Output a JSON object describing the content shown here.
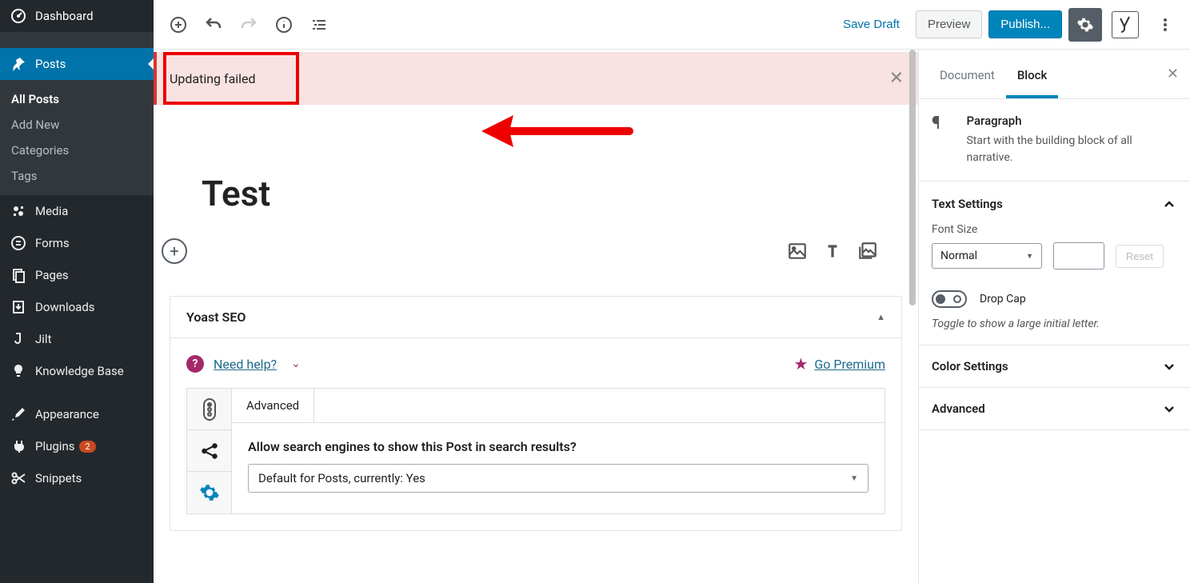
{
  "sidebar": {
    "dashboard": "Dashboard",
    "posts": "Posts",
    "sub": {
      "all": "All Posts",
      "add": "Add New",
      "categories": "Categories",
      "tags": "Tags"
    },
    "media": "Media",
    "forms": "Forms",
    "pages": "Pages",
    "downloads": "Downloads",
    "jilt": "Jilt",
    "kb": "Knowledge Base",
    "appearance": "Appearance",
    "plugins": "Plugins",
    "plugins_badge": "2",
    "snippets": "Snippets"
  },
  "topbar": {
    "save_draft": "Save Draft",
    "preview": "Preview",
    "publish": "Publish..."
  },
  "notice": {
    "text": "Updating failed"
  },
  "post": {
    "title": "Test"
  },
  "yoast": {
    "panel_title": "Yoast SEO",
    "need_help": "Need help?",
    "go_premium": "Go Premium",
    "advanced_tab": "Advanced",
    "question": "Allow search engines to show this Post in search results?",
    "select_value": "Default for Posts, currently: Yes"
  },
  "panel": {
    "tabs": {
      "document": "Document",
      "block": "Block"
    },
    "block_title": "Paragraph",
    "block_desc": "Start with the building block of all narrative.",
    "text_settings": "Text Settings",
    "font_size_label": "Font Size",
    "font_size_value": "Normal",
    "reset": "Reset",
    "drop_cap": "Drop Cap",
    "drop_cap_hint": "Toggle to show a large initial letter.",
    "color_settings": "Color Settings",
    "advanced": "Advanced"
  }
}
